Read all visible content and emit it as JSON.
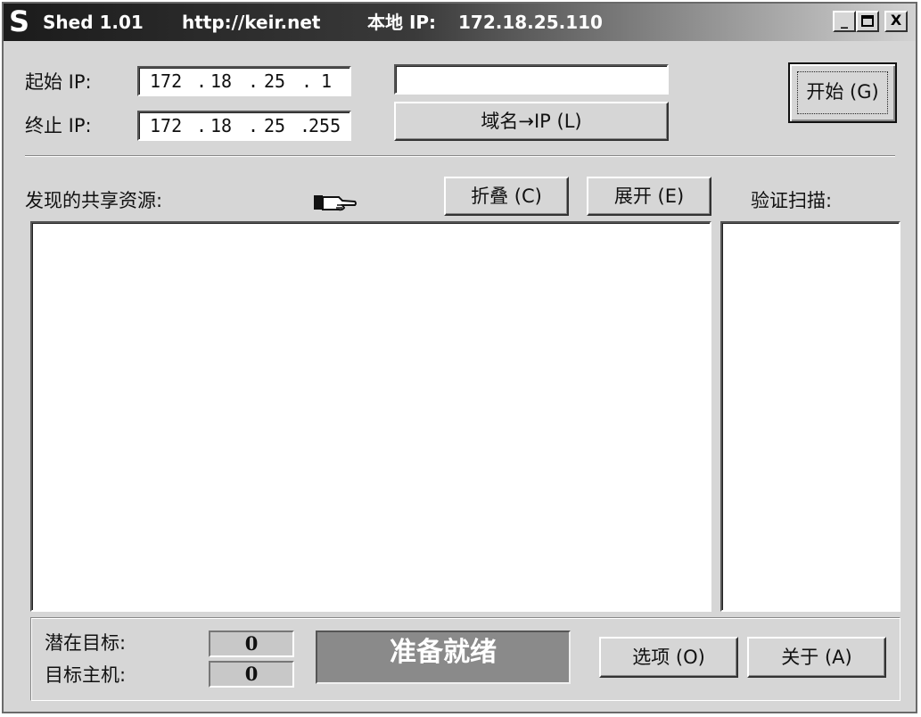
{
  "titlebar": {
    "logo": "S",
    "app_name": "Shed 1.01",
    "url": "http://keir.net",
    "local_ip_label": "本地 IP:",
    "local_ip": "172.18.25.110",
    "minimize": "_",
    "close": "X"
  },
  "form": {
    "start_ip_label": "起始 IP:",
    "end_ip_label": "终止 IP:",
    "start_ip": [
      "172",
      ".",
      "18",
      ".",
      "25",
      ".",
      "1"
    ],
    "end_ip": [
      "172",
      ".",
      "18",
      ".",
      "25",
      ".",
      "255"
    ],
    "domain_input": "",
    "domain_button": "域名→IP (L)",
    "start_button": "开始 (G)"
  },
  "shares": {
    "label": "发现的共享资源:",
    "collapse_button": "折叠 (C)",
    "expand_button": "展开 (E)",
    "verify_label": "验证扫描:"
  },
  "status": {
    "potential_label": "潜在目标:",
    "potential_value": "0",
    "host_label": "目标主机:",
    "host_value": "0",
    "state": "准备就绪",
    "options_button": "选项 (O)",
    "about_button": "关于 (A)"
  }
}
